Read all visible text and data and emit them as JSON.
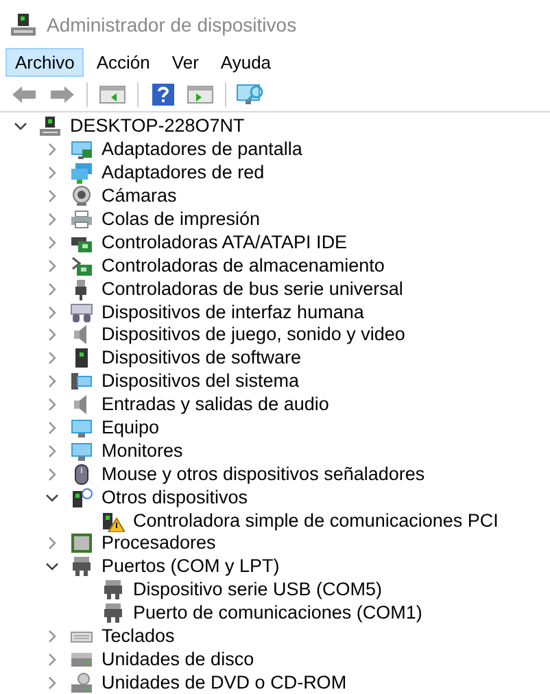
{
  "window": {
    "title": "Administrador de dispositivos"
  },
  "menu": [
    {
      "label": "Archivo",
      "selected": true
    },
    {
      "label": "Acción",
      "selected": false
    },
    {
      "label": "Ver",
      "selected": false
    },
    {
      "label": "Ayuda",
      "selected": false
    }
  ],
  "toolbar": [
    {
      "kind": "back"
    },
    {
      "kind": "forward"
    },
    {
      "kind": "sep"
    },
    {
      "kind": "panel-left"
    },
    {
      "kind": "sep"
    },
    {
      "kind": "help"
    },
    {
      "kind": "panel-right"
    },
    {
      "kind": "sep"
    },
    {
      "kind": "scan"
    }
  ],
  "tree": [
    {
      "label": "DESKTOP-228O7NT",
      "kind": "computer-root",
      "expanded": true,
      "children": [
        {
          "label": "Adaptadores de pantalla",
          "kind": "display",
          "expanded": false
        },
        {
          "label": "Adaptadores de red",
          "kind": "network",
          "expanded": false
        },
        {
          "label": "Cámaras",
          "kind": "camera",
          "expanded": false
        },
        {
          "label": "Colas de impresión",
          "kind": "printer",
          "expanded": false
        },
        {
          "label": "Controladoras ATA/ATAPI IDE",
          "kind": "card",
          "expanded": false
        },
        {
          "label": "Controladoras de almacenamiento",
          "kind": "storage",
          "expanded": false
        },
        {
          "label": "Controladoras de bus serie universal",
          "kind": "usb",
          "expanded": false
        },
        {
          "label": "Dispositivos de interfaz humana",
          "kind": "hid",
          "expanded": false
        },
        {
          "label": "Dispositivos de juego, sonido y video",
          "kind": "audio",
          "expanded": false
        },
        {
          "label": "Dispositivos de software",
          "kind": "software",
          "expanded": false
        },
        {
          "label": "Dispositivos del sistema",
          "kind": "system",
          "expanded": false
        },
        {
          "label": "Entradas y salidas de audio",
          "kind": "audio",
          "expanded": false
        },
        {
          "label": "Equipo",
          "kind": "monitor",
          "expanded": false
        },
        {
          "label": "Monitores",
          "kind": "monitor",
          "expanded": false
        },
        {
          "label": "Mouse y otros dispositivos señaladores",
          "kind": "mouse",
          "expanded": false
        },
        {
          "label": "Otros dispositivos",
          "kind": "other",
          "expanded": true,
          "children": [
            {
              "label": "Controladora simple de comunicaciones PCI",
              "kind": "warning"
            }
          ]
        },
        {
          "label": "Procesadores",
          "kind": "processor",
          "expanded": false
        },
        {
          "label": "Puertos (COM y LPT)",
          "kind": "port",
          "expanded": true,
          "children": [
            {
              "label": "Dispositivo serie USB (COM5)",
              "kind": "port"
            },
            {
              "label": "Puerto de comunicaciones (COM1)",
              "kind": "port"
            }
          ]
        },
        {
          "label": "Teclados",
          "kind": "keyboard",
          "expanded": false
        },
        {
          "label": "Unidades de disco",
          "kind": "disk",
          "expanded": false
        },
        {
          "label": "Unidades de DVD o CD-ROM",
          "kind": "dvd",
          "expanded": false
        }
      ]
    }
  ]
}
